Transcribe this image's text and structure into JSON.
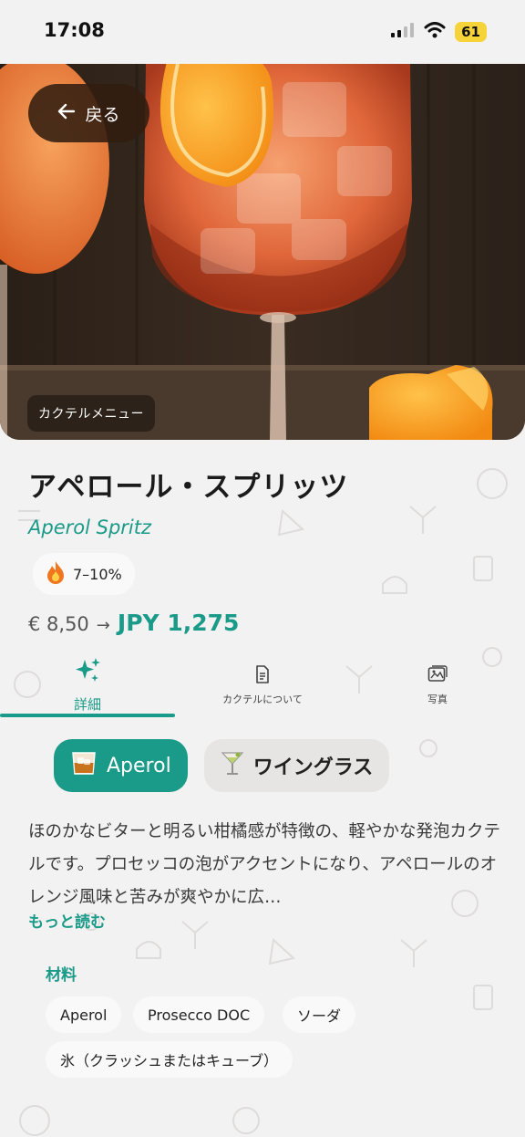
{
  "status": {
    "time": "17:08",
    "battery": "61"
  },
  "nav": {
    "back_label": "戻る"
  },
  "hero": {
    "badge": "カクテルメニュー"
  },
  "drink": {
    "title_ja": "アペロール・スプリッツ",
    "title_en": "Aperol Spritz",
    "abv": "7–10%",
    "price_eur": "€ 8,50",
    "price_arrow": "→",
    "price_jpy": "JPY 1,275"
  },
  "tabs": [
    {
      "label": "詳細",
      "icon": "sparkles-icon",
      "active": true
    },
    {
      "label": "カクテルについて",
      "icon": "document-icon",
      "active": false
    },
    {
      "label": "写真",
      "icon": "photo-icon",
      "active": false
    }
  ],
  "chips": {
    "base_spirit": {
      "label": "Aperol",
      "icon": "whiskey-glass-icon"
    },
    "glass": {
      "label": "ワイングラス",
      "icon": "cocktail-glass-icon"
    }
  },
  "description": "ほのかなビターと明るい柑橘感が特徴の、軽やかな発泡カクテルです。プロセッコの泡がアクセントになり、アペロールのオレンジ風味と苦みが爽やかに広…",
  "read_more": "もっと読む",
  "ingredients": {
    "title": "材料",
    "items": [
      "Aperol",
      "Prosecco DOC",
      "ソーダ",
      "氷（クラッシュまたはキューブ）"
    ]
  },
  "colors": {
    "accent": "#1a9a88",
    "battery": "#f7d33a"
  }
}
